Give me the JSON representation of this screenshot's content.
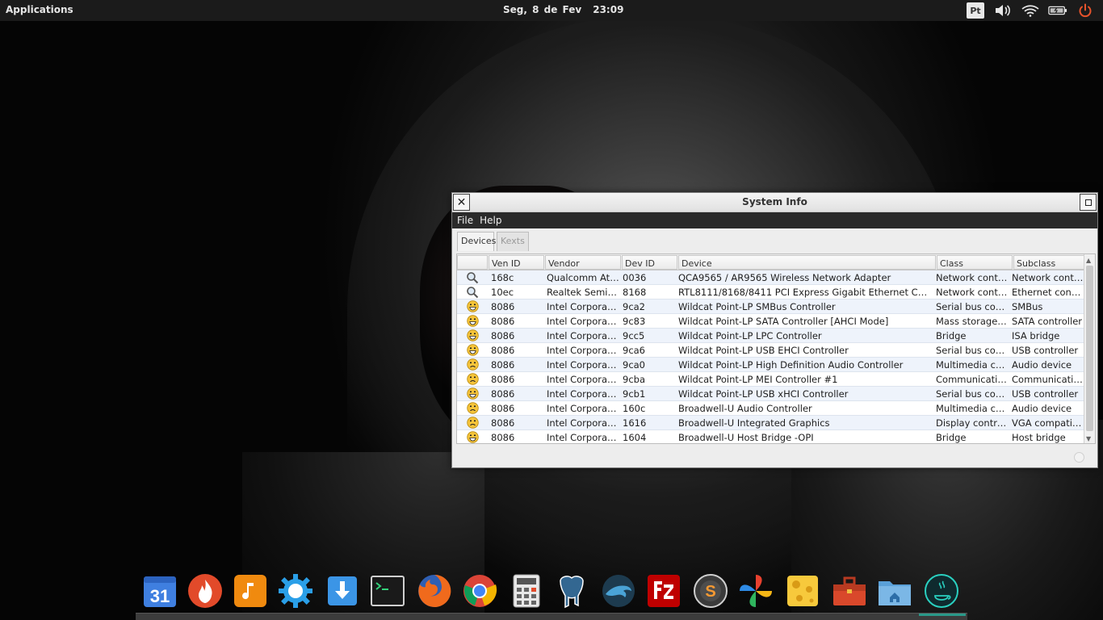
{
  "panel": {
    "applications_label": "Applications",
    "date": "Seg,  8 de Fev",
    "time": "23:09",
    "keyboard_layout": "Pt"
  },
  "window": {
    "title": "System Info",
    "menu": {
      "file": "File",
      "help": "Help"
    },
    "tabs": {
      "devices": "Devices",
      "kexts": "Kexts"
    },
    "columns": {
      "ven_id": "Ven ID",
      "vendor": "Vendor",
      "dev_id": "Dev ID",
      "device": "Device",
      "class": "Class",
      "subclass": "Subclass"
    },
    "rows": [
      {
        "icon": "search",
        "ven_id": "168c",
        "vendor": "Qualcomm Ath...",
        "dev_id": "0036",
        "device": "QCA9565 / AR9565 Wireless Network Adapter",
        "class": "Network contr...",
        "subclass": "Network contr..."
      },
      {
        "icon": "search",
        "ven_id": "10ec",
        "vendor": "Realtek Semic...",
        "dev_id": "8168",
        "device": "RTL8111/8168/8411 PCI Express Gigabit Ethernet Contro...",
        "class": "Network contr...",
        "subclass": "Ethernet contr..."
      },
      {
        "icon": "happy",
        "ven_id": "8086",
        "vendor": "Intel Corporati...",
        "dev_id": "9ca2",
        "device": "Wildcat Point-LP SMBus Controller",
        "class": "Serial bus cont...",
        "subclass": "SMBus"
      },
      {
        "icon": "happy",
        "ven_id": "8086",
        "vendor": "Intel Corporati...",
        "dev_id": "9c83",
        "device": "Wildcat Point-LP SATA Controller [AHCI Mode]",
        "class": "Mass storage ...",
        "subclass": "SATA controller"
      },
      {
        "icon": "happy",
        "ven_id": "8086",
        "vendor": "Intel Corporati...",
        "dev_id": "9cc5",
        "device": "Wildcat Point-LP LPC Controller",
        "class": "Bridge",
        "subclass": "ISA bridge"
      },
      {
        "icon": "happy",
        "ven_id": "8086",
        "vendor": "Intel Corporati...",
        "dev_id": "9ca6",
        "device": "Wildcat Point-LP USB EHCI Controller",
        "class": "Serial bus cont...",
        "subclass": "USB controller"
      },
      {
        "icon": "sad",
        "ven_id": "8086",
        "vendor": "Intel Corporati...",
        "dev_id": "9ca0",
        "device": "Wildcat Point-LP High Definition Audio Controller",
        "class": "Multimedia co...",
        "subclass": "Audio device"
      },
      {
        "icon": "sad",
        "ven_id": "8086",
        "vendor": "Intel Corporati...",
        "dev_id": "9cba",
        "device": "Wildcat Point-LP MEI Controller #1",
        "class": "Communicatio...",
        "subclass": "Communicatio..."
      },
      {
        "icon": "happy",
        "ven_id": "8086",
        "vendor": "Intel Corporati...",
        "dev_id": "9cb1",
        "device": "Wildcat Point-LP USB xHCI Controller",
        "class": "Serial bus cont...",
        "subclass": "USB controller"
      },
      {
        "icon": "sad",
        "ven_id": "8086",
        "vendor": "Intel Corporati...",
        "dev_id": "160c",
        "device": "Broadwell-U Audio Controller",
        "class": "Multimedia co...",
        "subclass": "Audio device"
      },
      {
        "icon": "sad",
        "ven_id": "8086",
        "vendor": "Intel Corporati...",
        "dev_id": "1616",
        "device": "Broadwell-U Integrated Graphics",
        "class": "Display control...",
        "subclass": "VGA compatibl..."
      },
      {
        "icon": "happy",
        "ven_id": "8086",
        "vendor": "Intel Corporati...",
        "dev_id": "1604",
        "device": "Broadwell-U Host Bridge -OPI",
        "class": "Bridge",
        "subclass": "Host bridge"
      }
    ]
  },
  "dock": {
    "calendar_day": "31",
    "items": [
      "calendar-icon",
      "burner-icon",
      "music-icon",
      "settings-icon",
      "downloads-icon",
      "terminal-icon",
      "firefox-icon",
      "chrome-icon",
      "calculator-icon",
      "postgresql-icon",
      "mysql-workbench-icon",
      "filezilla-icon",
      "sublime-text-icon",
      "pinwheel-icon",
      "cheese-icon",
      "toolbox-icon",
      "home-folder-icon",
      "java-icon"
    ]
  }
}
